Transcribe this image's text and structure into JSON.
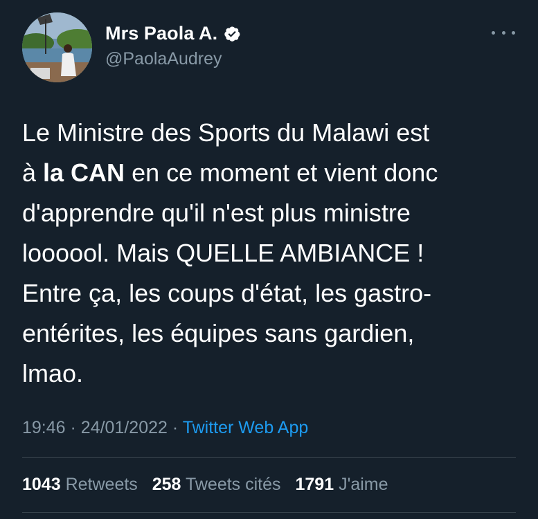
{
  "author": {
    "display_name": "Mrs Paola A.",
    "handle": "@PaolaAudrey",
    "verified": true,
    "avatar_icon": "profile-photo"
  },
  "tweet": {
    "text_before_bold": "Le Ministre des Sports du Malawi est\nà ",
    "text_bold": "la CAN",
    "text_after_bold": " en ce moment et vient donc\nd'apprendre qu'il n'est plus ministre\nloooool. Mais QUELLE AMBIANCE !\nEntre ça, les coups d'état, les gastro-\nentérites, les équipes sans gardien,\nlmao."
  },
  "meta": {
    "time": "19:46",
    "separator": "·",
    "date": "24/01/2022",
    "source": "Twitter Web App"
  },
  "stats": {
    "retweets_count": "1043",
    "retweets_label": "Retweets",
    "quotes_count": "258",
    "quotes_label": "Tweets cités",
    "likes_count": "1791",
    "likes_label": "J'aime"
  },
  "colors": {
    "background": "#15202b",
    "text": "#ffffff",
    "secondary": "#8899a6",
    "link": "#1d9bf0",
    "divider": "#38444d"
  }
}
